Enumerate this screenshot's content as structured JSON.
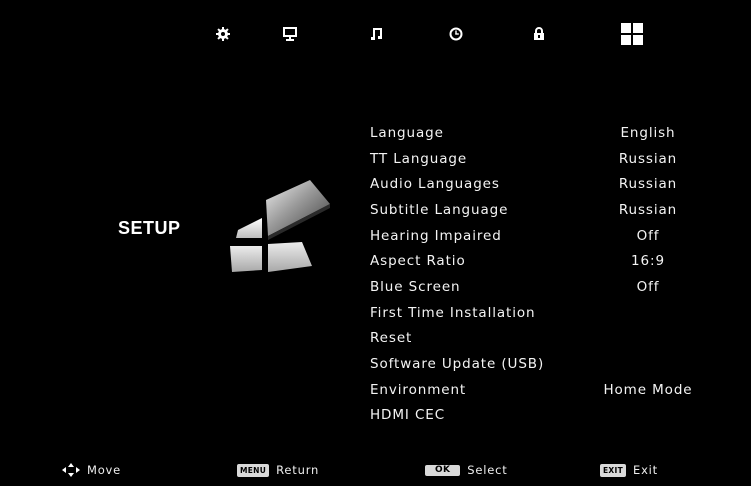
{
  "top_menu": {
    "tabs": [
      {
        "name": "picture",
        "icon": "gear-icon"
      },
      {
        "name": "channel",
        "icon": "monitor-icon"
      },
      {
        "name": "sound",
        "icon": "music-note-icon"
      },
      {
        "name": "time",
        "icon": "clock-icon"
      },
      {
        "name": "lock",
        "icon": "padlock-icon"
      },
      {
        "name": "setup",
        "icon": "grid-icon",
        "selected": true
      }
    ]
  },
  "page": {
    "title": "SETUP"
  },
  "menu": {
    "items": [
      {
        "label": "Language",
        "value": "English"
      },
      {
        "label": "TT Language",
        "value": "Russian"
      },
      {
        "label": "Audio Languages",
        "value": "Russian"
      },
      {
        "label": "Subtitle Language",
        "value": "Russian"
      },
      {
        "label": "Hearing Impaired",
        "value": "Off"
      },
      {
        "label": "Aspect Ratio",
        "value": "16:9"
      },
      {
        "label": "Blue Screen",
        "value": "Off"
      },
      {
        "label": "First Time Installation",
        "value": ""
      },
      {
        "label": "Reset",
        "value": ""
      },
      {
        "label": "Software Update (USB)",
        "value": ""
      },
      {
        "label": "Environment",
        "value": "Home Mode"
      },
      {
        "label": "HDMI CEC",
        "value": ""
      }
    ]
  },
  "footer": {
    "move_label": "Move",
    "menu_key": "MENU",
    "return_label": "Return",
    "ok_key": "OK",
    "select_label": "Select",
    "exit_key": "EXIT",
    "exit_label": "Exit"
  },
  "colors": {
    "background": "#000000",
    "text": "#f2f2f2",
    "keycap": "#d9d9d9"
  }
}
